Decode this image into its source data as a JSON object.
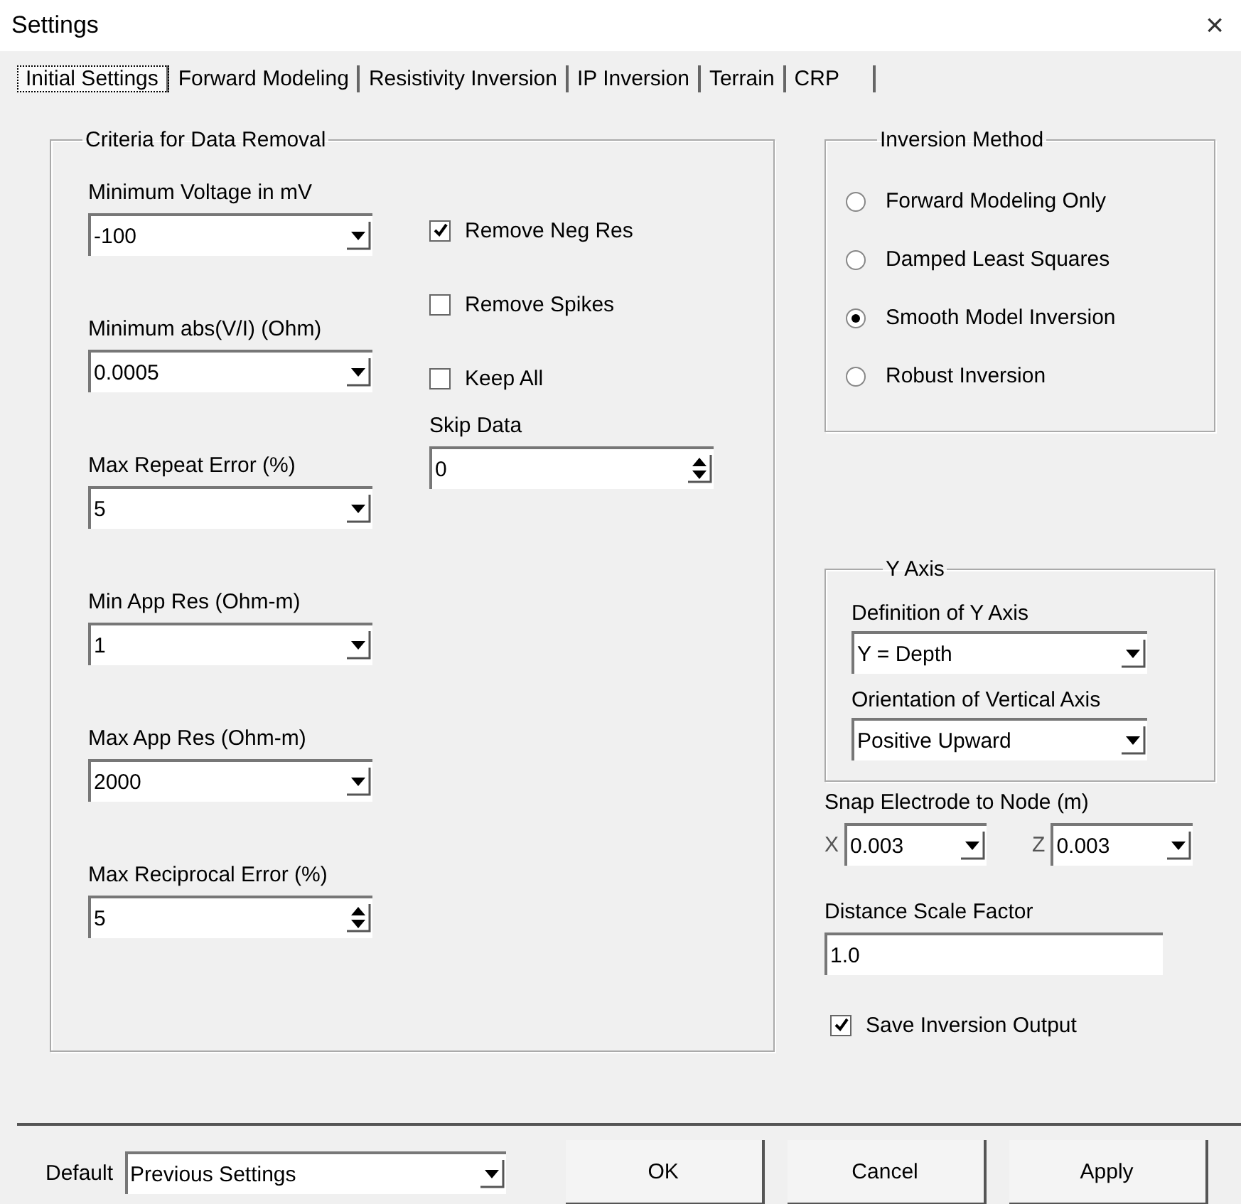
{
  "window": {
    "title": "Settings",
    "close": "×"
  },
  "tabs": [
    {
      "label": "Initial Settings",
      "selected": true
    },
    {
      "label": "Forward Modeling",
      "selected": false
    },
    {
      "label": "Resistivity Inversion",
      "selected": false
    },
    {
      "label": "IP Inversion",
      "selected": false
    },
    {
      "label": "Terrain",
      "selected": false
    },
    {
      "label": "CRP",
      "selected": false
    }
  ],
  "data_removal": {
    "title": "Criteria for Data Removal",
    "fields": [
      {
        "label": "Minimum Voltage in mV",
        "value": "-100",
        "kind": "dropdown"
      },
      {
        "label": "Minimum abs(V/I) (Ohm)",
        "value": "0.0005",
        "kind": "dropdown"
      },
      {
        "label": "Max Repeat Error (%)",
        "value": "5",
        "kind": "dropdown"
      },
      {
        "label": "Min App Res (Ohm-m)",
        "value": "1",
        "kind": "dropdown"
      },
      {
        "label": "Max App Res (Ohm-m)",
        "value": "2000",
        "kind": "dropdown"
      },
      {
        "label": "Max Reciprocal Error (%)",
        "value": "5",
        "kind": "spinner"
      }
    ],
    "checkboxes": [
      {
        "label": "Remove Neg Res",
        "checked": true
      },
      {
        "label": "Remove Spikes",
        "checked": false
      },
      {
        "label": "Keep All",
        "checked": false
      }
    ],
    "skip_data": {
      "label": "Skip Data",
      "value": "0"
    }
  },
  "inversion_method": {
    "title": "Inversion Method",
    "options": [
      {
        "label": "Forward Modeling Only",
        "selected": false
      },
      {
        "label": "Damped Least Squares",
        "selected": false
      },
      {
        "label": "Smooth Model Inversion",
        "selected": true
      },
      {
        "label": "Robust Inversion",
        "selected": false
      }
    ]
  },
  "y_axis": {
    "title": "Y Axis",
    "fields": [
      {
        "label": "Definition of Y Axis",
        "value": "Y = Depth"
      },
      {
        "label": "Orientation of Vertical Axis",
        "value": "Positive Upward"
      }
    ]
  },
  "snap": {
    "label": "Snap Electrode to Node (m)",
    "x_label": "X",
    "x_value": "0.003",
    "z_label": "Z",
    "z_value": "0.003"
  },
  "distance": {
    "label": "Distance Scale Factor",
    "value": "1.0"
  },
  "save_output": {
    "label": "Save Inversion Output",
    "checked": true
  },
  "footer": {
    "default_label": "Default",
    "default_value": "Previous Settings",
    "buttons": [
      "OK",
      "Cancel",
      "Apply"
    ]
  }
}
